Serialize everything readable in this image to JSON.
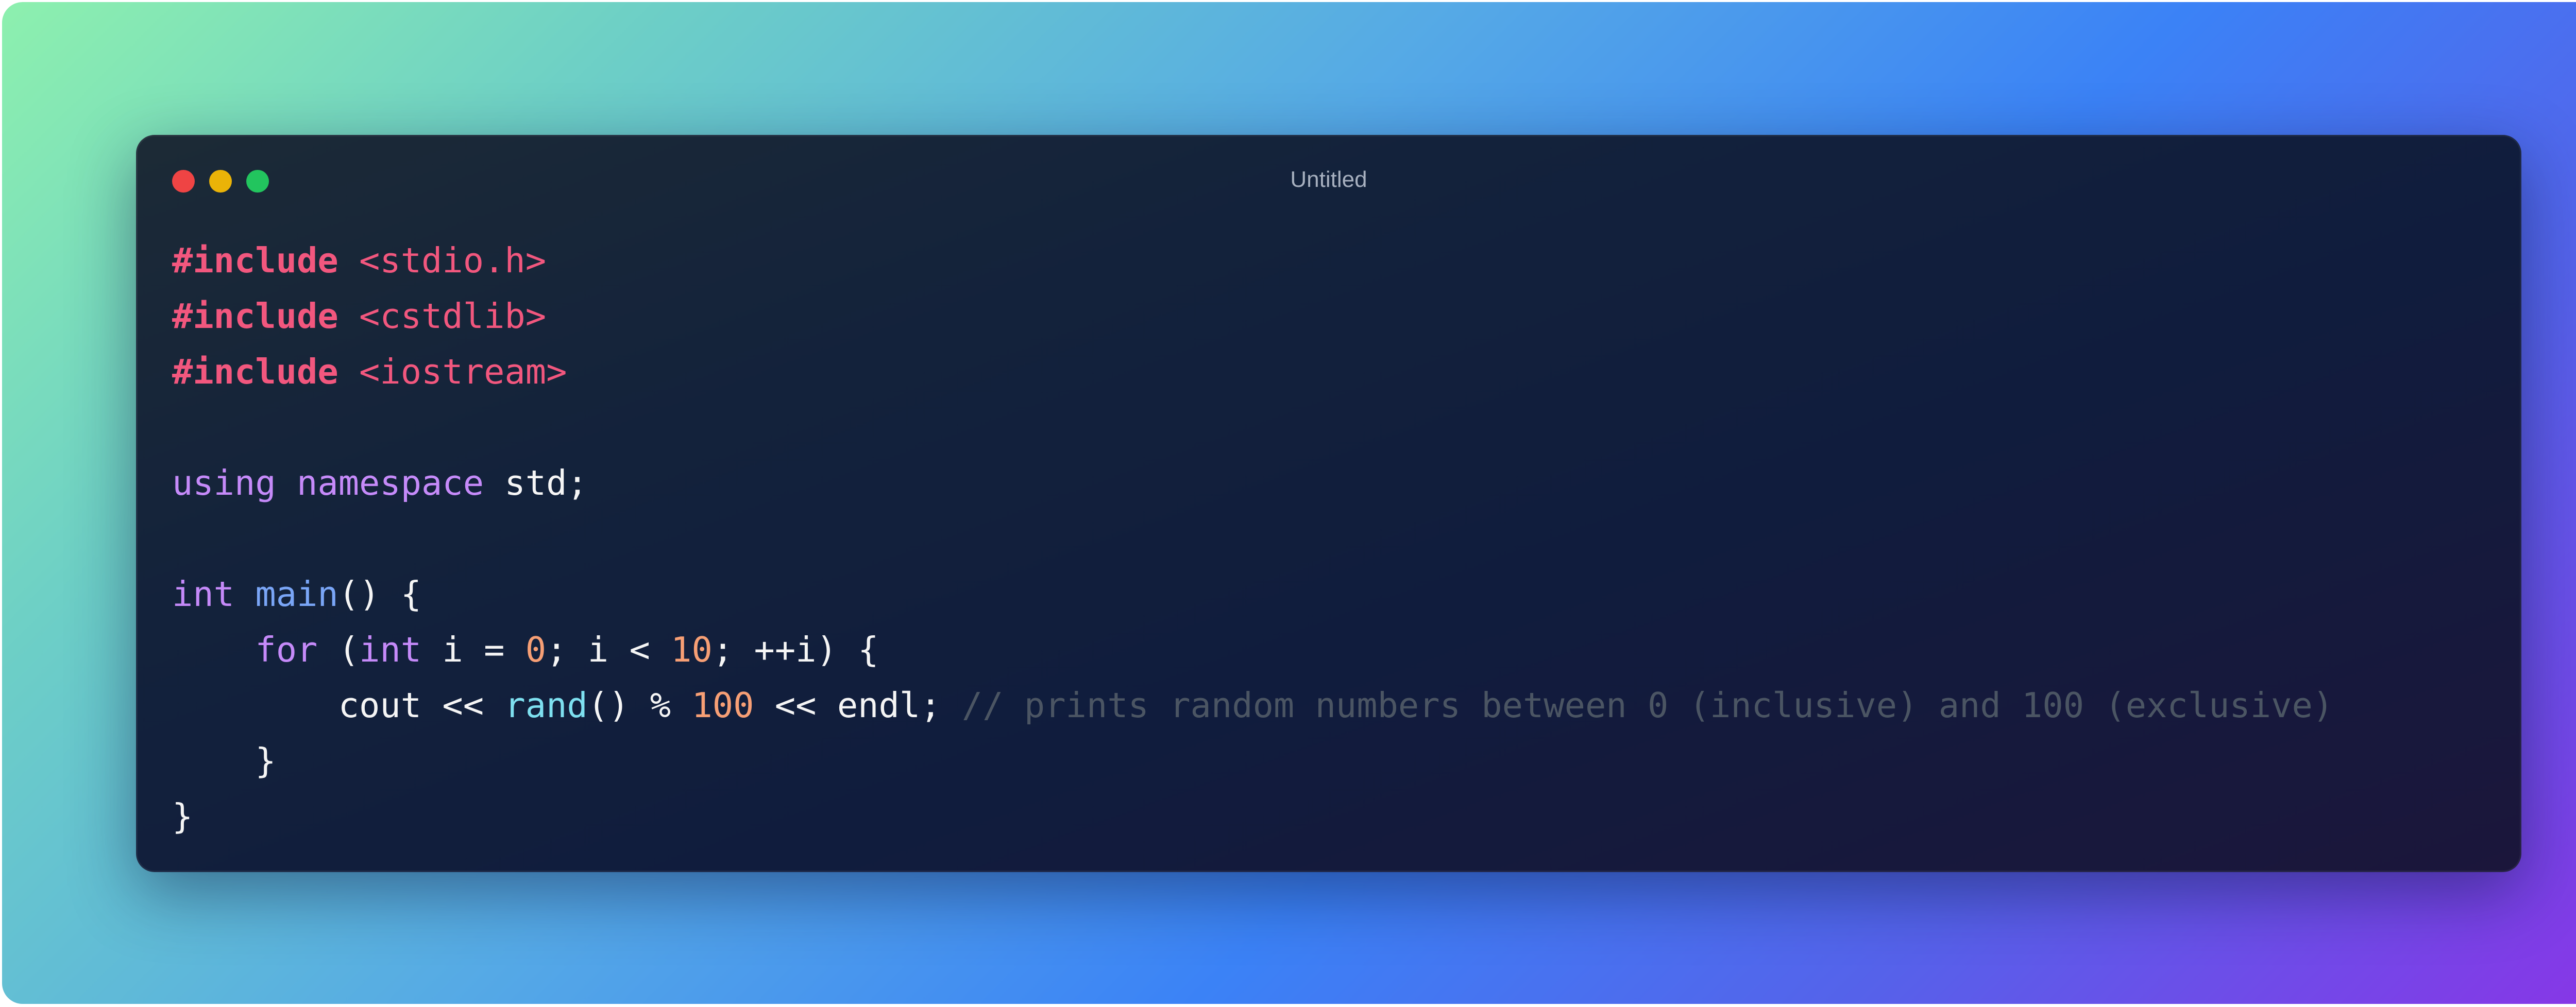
{
  "window": {
    "title": "Untitled",
    "buttons": [
      "close",
      "minimize",
      "maximize"
    ]
  },
  "code": {
    "lines": [
      [
        {
          "t": "#include",
          "k": "inc"
        },
        {
          "t": " ",
          "k": ""
        },
        {
          "t": "<stdio.h>",
          "k": "hdr"
        }
      ],
      [
        {
          "t": "#include",
          "k": "inc"
        },
        {
          "t": " ",
          "k": ""
        },
        {
          "t": "<cstdlib>",
          "k": "hdr"
        }
      ],
      [
        {
          "t": "#include",
          "k": "inc"
        },
        {
          "t": " ",
          "k": ""
        },
        {
          "t": "<iostream>",
          "k": "hdr"
        }
      ],
      [],
      [
        {
          "t": "using",
          "k": "kw"
        },
        {
          "t": " ",
          "k": ""
        },
        {
          "t": "namespace",
          "k": "kw"
        },
        {
          "t": " std;",
          "k": ""
        }
      ],
      [],
      [
        {
          "t": "int",
          "k": "kw"
        },
        {
          "t": " ",
          "k": ""
        },
        {
          "t": "main",
          "k": "fn"
        },
        {
          "t": "() {",
          "k": ""
        }
      ],
      [
        {
          "t": "    ",
          "k": ""
        },
        {
          "t": "for",
          "k": "kw"
        },
        {
          "t": " (",
          "k": ""
        },
        {
          "t": "int",
          "k": "kw"
        },
        {
          "t": " i = ",
          "k": ""
        },
        {
          "t": "0",
          "k": "num"
        },
        {
          "t": "; i < ",
          "k": ""
        },
        {
          "t": "10",
          "k": "num"
        },
        {
          "t": "; ++i) {",
          "k": ""
        }
      ],
      [
        {
          "t": "        cout << ",
          "k": ""
        },
        {
          "t": "rand",
          "k": "call"
        },
        {
          "t": "() % ",
          "k": ""
        },
        {
          "t": "100",
          "k": "num"
        },
        {
          "t": " << endl; ",
          "k": ""
        },
        {
          "t": "// prints random numbers between 0 (inclusive) and 100 (exclusive)",
          "k": "cmt"
        }
      ],
      [
        {
          "t": "    }",
          "k": ""
        }
      ],
      [
        {
          "t": "}",
          "k": ""
        }
      ]
    ]
  }
}
